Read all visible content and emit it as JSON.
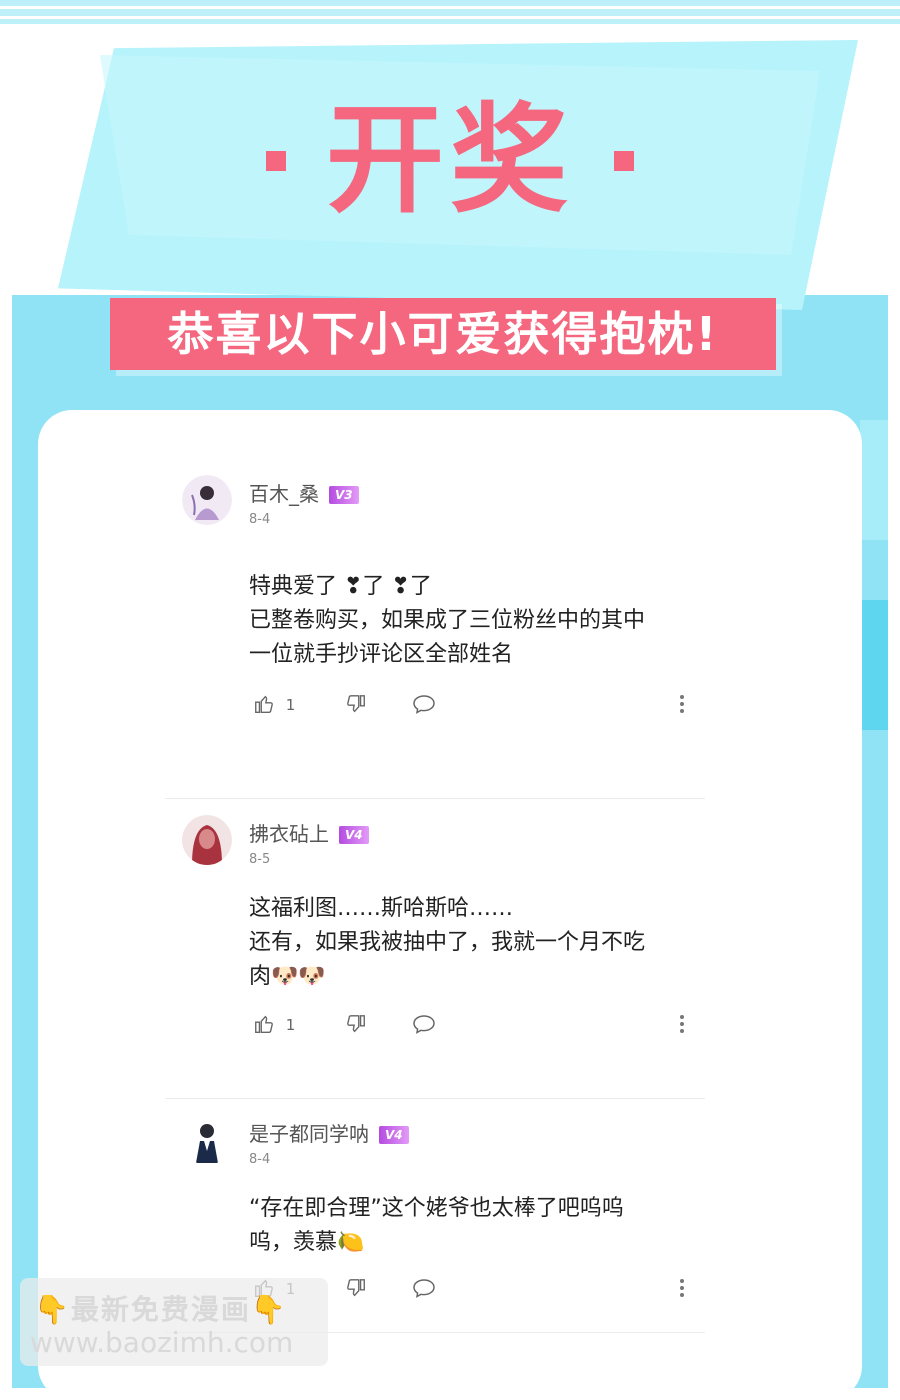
{
  "header": {
    "title": "开奖",
    "banner": "恭喜以下小可爱获得抱枕!"
  },
  "comments": [
    {
      "username": "百木_桑",
      "level": "V3",
      "date": "8-4",
      "lines": [
        "特典爱了 ❣了 ❣了",
        "已整卷购买，如果成了三位粉丝中的其中",
        "一位就手抄评论区全部姓名"
      ],
      "likes": "1"
    },
    {
      "username": "拂衣砧上",
      "level": "V4",
      "date": "8-5",
      "lines": [
        "这福利图……斯哈斯哈……",
        "还有，如果我被抽中了，我就一个月不吃",
        "肉🐶🐶"
      ],
      "likes": "1"
    },
    {
      "username": "是子都同学呐",
      "level": "V4",
      "date": "8-4",
      "lines": [
        "“存在即合理”这个姥爷也太棒了吧呜呜",
        "呜，羡慕🍋"
      ],
      "likes": "1"
    }
  ],
  "icons": {
    "like": "thumbs-up-icon",
    "dislike": "thumbs-down-icon",
    "reply": "comment-bubble-icon",
    "more": "more-vertical-icon"
  },
  "watermark": {
    "line1": "最新免费漫画",
    "line2": "www.baozimh.com"
  },
  "colors": {
    "accent": "#f4677f",
    "teal": "#8fe3f5",
    "badge": "#c25ae6"
  }
}
